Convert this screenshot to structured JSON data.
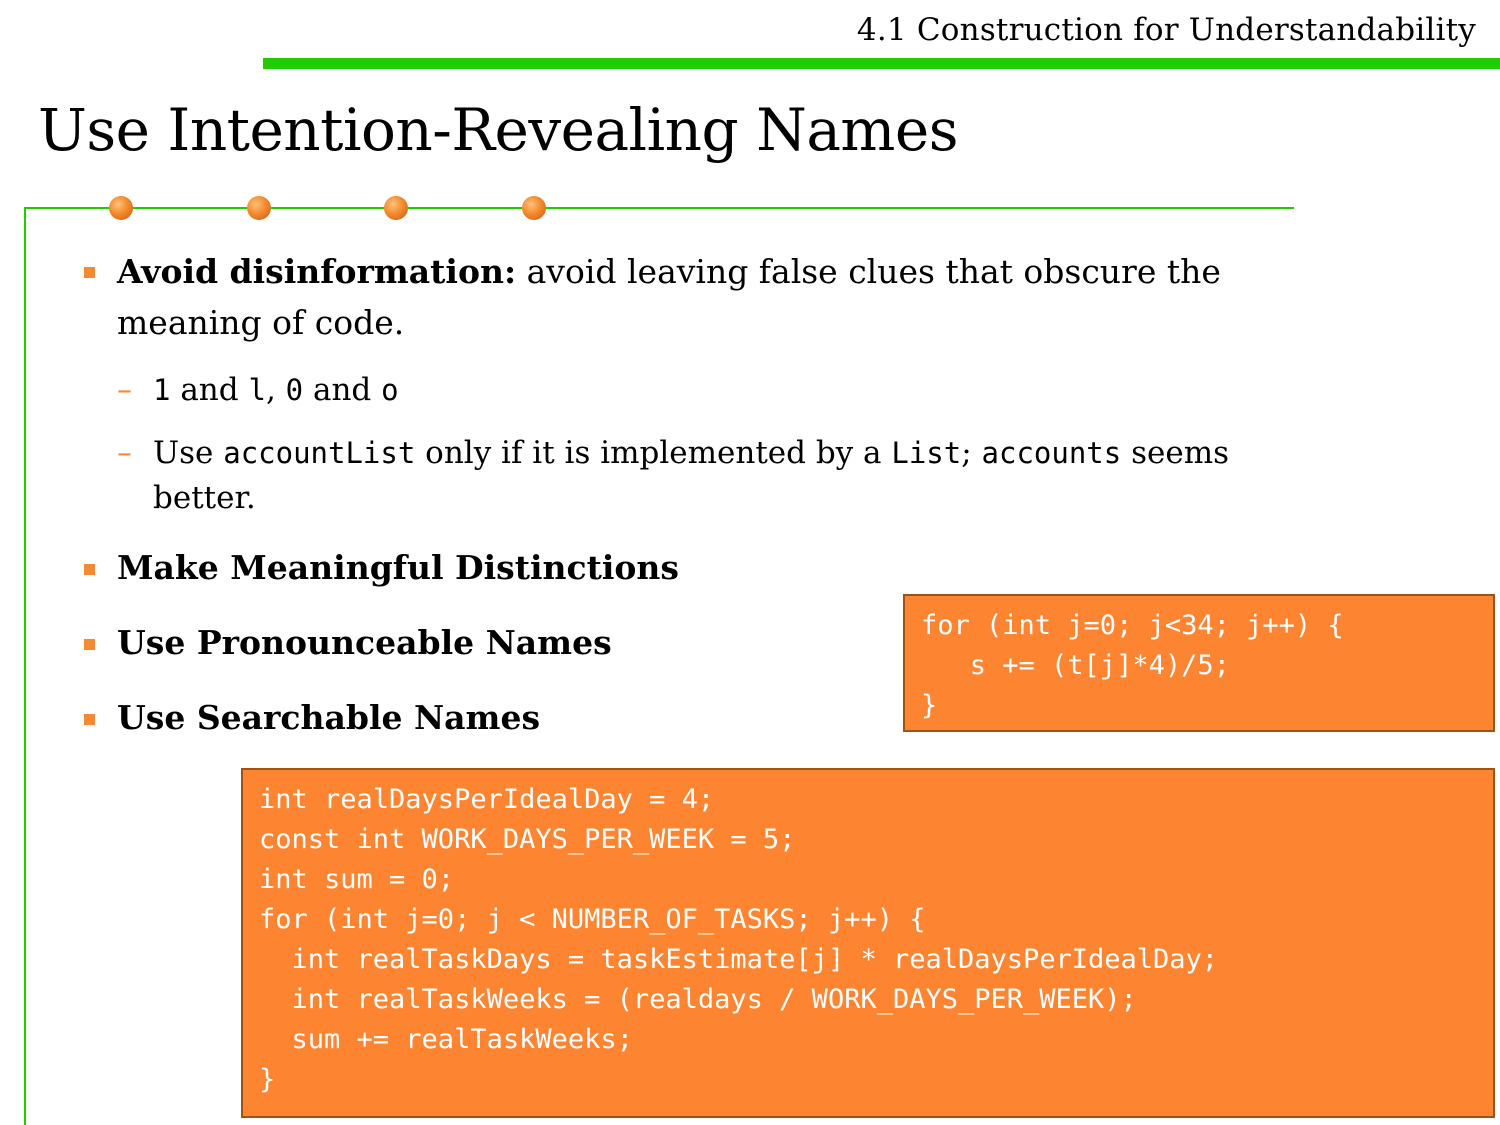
{
  "header": {
    "section": "4.1 Construction for Understandability",
    "bar_color": "#22cc00"
  },
  "title": "Use Intention-Revealing Names",
  "colors": {
    "accent": "#f58a32",
    "code_bg": "#fd8430",
    "frame": "#22cc00"
  },
  "bullets": {
    "b1": {
      "bold": "Avoid disinformation:",
      "text_line1": " avoid leaving false clues that obscure the",
      "text_line2": "meaning of code.",
      "sub1": {
        "c1": "1",
        "t1": " and ",
        "c2": "l",
        "t2": ", ",
        "c3": "0",
        "t3": " and ",
        "c4": "o"
      },
      "sub2": {
        "t1": "Use ",
        "c1": "accountList",
        "t2": " only if it is implemented by a ",
        "c2": "List",
        "t3": "; ",
        "c3": "accounts",
        "t4": " seems",
        "line2": "better."
      }
    },
    "b2": "Make Meaningful Distinctions",
    "b3": "Use Pronounceable Names",
    "b4": "Use Searchable Names"
  },
  "code_small": [
    "for (int j=0; j<34; j++) {",
    "   s += (t[j]*4)/5;",
    "}"
  ],
  "code_large": [
    "int realDaysPerIdealDay = 4;",
    "const int WORK_DAYS_PER_WEEK = 5;",
    "int sum = 0;",
    "for (int j=0; j < NUMBER_OF_TASKS; j++) {",
    "  int realTaskDays = taskEstimate[j] * realDaysPerIdealDay;",
    "  int realTaskWeeks = (realdays / WORK_DAYS_PER_WEEK);",
    "  sum += realTaskWeeks;",
    "}"
  ]
}
